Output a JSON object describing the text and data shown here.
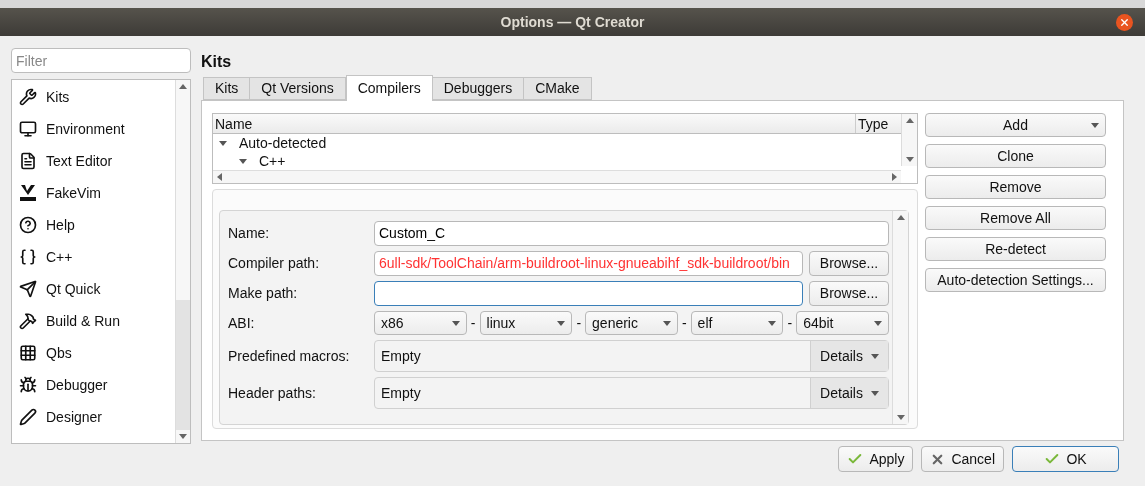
{
  "window": {
    "title": "Options — Qt Creator"
  },
  "filter": {
    "placeholder": "Filter"
  },
  "sidebar": {
    "items": [
      {
        "label": "Kits"
      },
      {
        "label": "Environment"
      },
      {
        "label": "Text Editor"
      },
      {
        "label": "FakeVim"
      },
      {
        "label": "Help"
      },
      {
        "label": "C++"
      },
      {
        "label": "Qt Quick"
      },
      {
        "label": "Build & Run"
      },
      {
        "label": "Qbs"
      },
      {
        "label": "Debugger"
      },
      {
        "label": "Designer"
      }
    ]
  },
  "page_title": "Kits",
  "tabs": [
    {
      "label": "Kits",
      "selected": false
    },
    {
      "label": "Qt Versions",
      "selected": false
    },
    {
      "label": "Compilers",
      "selected": true
    },
    {
      "label": "Debuggers",
      "selected": false
    },
    {
      "label": "CMake",
      "selected": false
    }
  ],
  "tree": {
    "columns": [
      "Name",
      "Type"
    ],
    "rows": [
      {
        "label": "Auto-detected",
        "expanded": true,
        "children": [
          {
            "label": "C++",
            "expanded": true
          }
        ]
      }
    ]
  },
  "side_buttons": [
    {
      "label": "Add",
      "kind": "dropdown"
    },
    {
      "label": "Clone",
      "kind": "plain"
    },
    {
      "label": "Remove",
      "kind": "plain"
    },
    {
      "label": "Remove All",
      "kind": "plain"
    },
    {
      "label": "Re-detect",
      "kind": "plain"
    },
    {
      "label": "Auto-detection Settings...",
      "kind": "plain"
    }
  ],
  "form": [
    {
      "kind": "text",
      "label": "Name:",
      "value": "Custom_C",
      "invalid": false,
      "focused": false
    },
    {
      "kind": "path",
      "label": "Compiler path:",
      "value": "6ull-sdk/ToolChain/arm-buildroot-linux-gnueabihf_sdk-buildroot/bin",
      "invalid": true,
      "focused": false,
      "button": "Browse..."
    },
    {
      "kind": "path",
      "label": "Make path:",
      "focused": true,
      "button": "Browse..."
    },
    {
      "kind": "abi",
      "label": "ABI:",
      "options": [
        "x86",
        "linux",
        "generic",
        "elf",
        "64bit"
      ],
      "separator": "-"
    },
    {
      "kind": "details",
      "label": "Predefined macros:",
      "value": "Empty",
      "button": "Details"
    },
    {
      "kind": "details",
      "label": "Header paths:",
      "value": "Empty",
      "button": "Details"
    }
  ],
  "dialog_buttons": [
    {
      "label": "Apply",
      "default": false
    },
    {
      "label": "Cancel",
      "default": false
    },
    {
      "label": "OK",
      "default": true
    }
  ]
}
